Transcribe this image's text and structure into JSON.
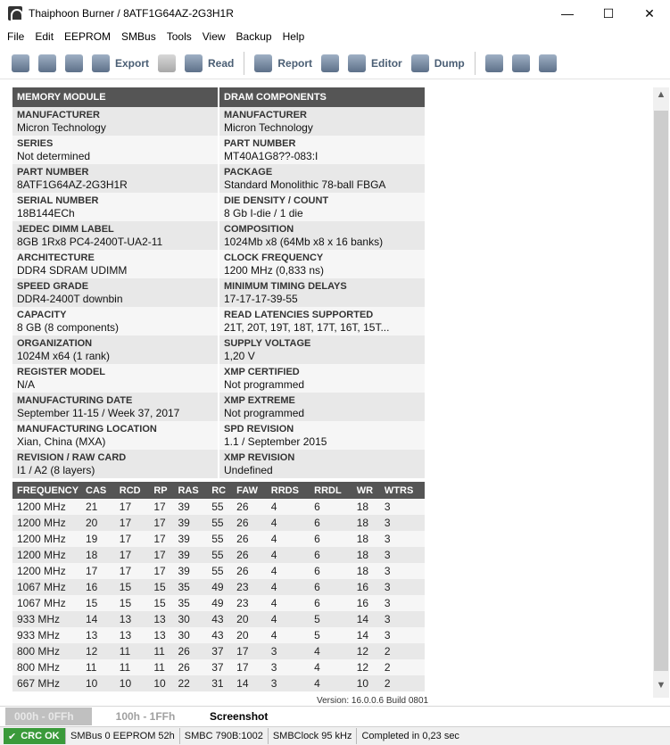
{
  "window": {
    "title": "Thaiphoon Burner / 8ATF1G64AZ-2G3H1R"
  },
  "menu": [
    "File",
    "Edit",
    "EEPROM",
    "SMBus",
    "Tools",
    "View",
    "Backup",
    "Help"
  ],
  "toolbar": {
    "export_label": "Export",
    "read_label": "Read",
    "report_label": "Report",
    "editor_label": "Editor",
    "dump_label": "Dump"
  },
  "module": {
    "header_left": "MEMORY MODULE",
    "header_right": "DRAM COMPONENTS",
    "rows": [
      {
        "l_label": "MANUFACTURER",
        "l_value": "Micron Technology",
        "r_label": "MANUFACTURER",
        "r_value": "Micron Technology"
      },
      {
        "l_label": "SERIES",
        "l_value": "Not determined",
        "r_label": "PART NUMBER",
        "r_value": "MT40A1G8??-083:I"
      },
      {
        "l_label": "PART NUMBER",
        "l_value": "8ATF1G64AZ-2G3H1R",
        "r_label": "PACKAGE",
        "r_value": "Standard Monolithic 78-ball FBGA"
      },
      {
        "l_label": "SERIAL NUMBER",
        "l_value": "18B144ECh",
        "r_label": "DIE DENSITY / COUNT",
        "r_value": "8 Gb I-die / 1 die"
      },
      {
        "l_label": "JEDEC DIMM LABEL",
        "l_value": "8GB 1Rx8 PC4-2400T-UA2-11",
        "r_label": "COMPOSITION",
        "r_value": "1024Mb x8 (64Mb x8 x 16 banks)"
      },
      {
        "l_label": "ARCHITECTURE",
        "l_value": "DDR4 SDRAM UDIMM",
        "r_label": "CLOCK FREQUENCY",
        "r_value": "1200 MHz (0,833 ns)"
      },
      {
        "l_label": "SPEED GRADE",
        "l_value": "DDR4-2400T downbin",
        "r_label": "MINIMUM TIMING DELAYS",
        "r_value": "17-17-17-39-55"
      },
      {
        "l_label": "CAPACITY",
        "l_value": "8 GB (8 components)",
        "r_label": "READ LATENCIES SUPPORTED",
        "r_value": "21T, 20T, 19T, 18T, 17T, 16T, 15T..."
      },
      {
        "l_label": "ORGANIZATION",
        "l_value": "1024M x64 (1 rank)",
        "r_label": "SUPPLY VOLTAGE",
        "r_value": "1,20 V"
      },
      {
        "l_label": "REGISTER MODEL",
        "l_value": "N/A",
        "r_label": "XMP CERTIFIED",
        "r_value": "Not programmed"
      },
      {
        "l_label": "MANUFACTURING DATE",
        "l_value": "September 11-15 / Week 37, 2017",
        "r_label": "XMP EXTREME",
        "r_value": "Not programmed"
      },
      {
        "l_label": "MANUFACTURING LOCATION",
        "l_value": "Xian, China (MXA)",
        "r_label": "SPD REVISION",
        "r_value": "1.1 / September 2015"
      },
      {
        "l_label": "REVISION / RAW CARD",
        "l_value": "I1 / A2 (8 layers)",
        "r_label": "XMP REVISION",
        "r_value": "Undefined"
      }
    ]
  },
  "timings": {
    "columns": [
      "FREQUENCY",
      "CAS",
      "RCD",
      "RP",
      "RAS",
      "RC",
      "FAW",
      "RRDS",
      "RRDL",
      "WR",
      "WTRS"
    ],
    "rows": [
      [
        "1200 MHz",
        "21",
        "17",
        "17",
        "39",
        "55",
        "26",
        "4",
        "6",
        "18",
        "3"
      ],
      [
        "1200 MHz",
        "20",
        "17",
        "17",
        "39",
        "55",
        "26",
        "4",
        "6",
        "18",
        "3"
      ],
      [
        "1200 MHz",
        "19",
        "17",
        "17",
        "39",
        "55",
        "26",
        "4",
        "6",
        "18",
        "3"
      ],
      [
        "1200 MHz",
        "18",
        "17",
        "17",
        "39",
        "55",
        "26",
        "4",
        "6",
        "18",
        "3"
      ],
      [
        "1200 MHz",
        "17",
        "17",
        "17",
        "39",
        "55",
        "26",
        "4",
        "6",
        "18",
        "3"
      ],
      [
        "1067 MHz",
        "16",
        "15",
        "15",
        "35",
        "49",
        "23",
        "4",
        "6",
        "16",
        "3"
      ],
      [
        "1067 MHz",
        "15",
        "15",
        "15",
        "35",
        "49",
        "23",
        "4",
        "6",
        "16",
        "3"
      ],
      [
        "933 MHz",
        "14",
        "13",
        "13",
        "30",
        "43",
        "20",
        "4",
        "5",
        "14",
        "3"
      ],
      [
        "933 MHz",
        "13",
        "13",
        "13",
        "30",
        "43",
        "20",
        "4",
        "5",
        "14",
        "3"
      ],
      [
        "800 MHz",
        "12",
        "11",
        "11",
        "26",
        "37",
        "17",
        "3",
        "4",
        "12",
        "2"
      ],
      [
        "800 MHz",
        "11",
        "11",
        "11",
        "26",
        "37",
        "17",
        "3",
        "4",
        "12",
        "2"
      ],
      [
        "667 MHz",
        "10",
        "10",
        "10",
        "22",
        "31",
        "14",
        "3",
        "4",
        "10",
        "2"
      ]
    ]
  },
  "version": "Version: 16.0.0.6 Build 0801",
  "tabs": [
    "000h - 0FFh",
    "100h - 1FFh",
    "Screenshot"
  ],
  "status": {
    "crc": "CRC OK",
    "smbus": "SMBus 0 EEPROM 52h",
    "smbc": "SMBC 790B:1002",
    "clock": "SMBClock 95 kHz",
    "completed": "Completed in 0,23 sec"
  },
  "colors": {
    "header_bg": "#555555",
    "row_dark": "#e8e8e8",
    "row_light": "#f6f6f6",
    "crc_ok": "#3a9a3a"
  }
}
